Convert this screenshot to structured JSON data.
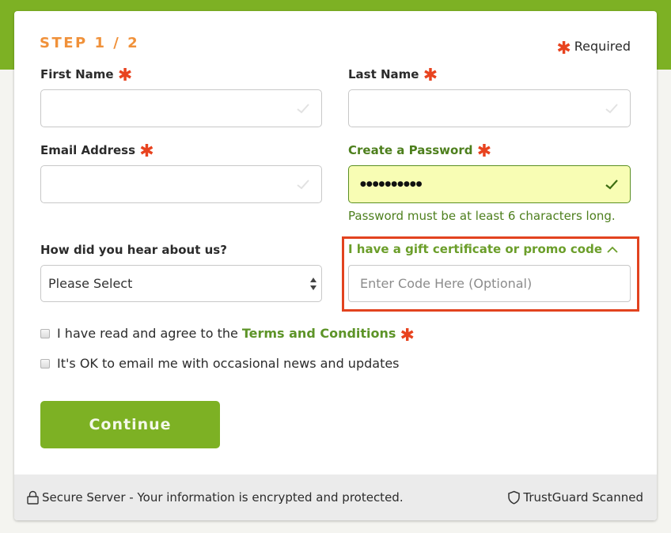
{
  "colors": {
    "brand_green": "#7db124",
    "step_orange": "#f0913a",
    "required_red": "#e8431f",
    "valid_bg": "#f8fdb4",
    "link_green": "#5d9428",
    "highlight_red": "#e2431f"
  },
  "header": {
    "step_label": "STEP 1 / 2",
    "required_asterisk": "✱",
    "required_label": "Required"
  },
  "fields": {
    "first_name": {
      "label": "First Name",
      "asterisk": "✱",
      "value": "",
      "placeholder": "",
      "icon": "check-icon"
    },
    "last_name": {
      "label": "Last Name",
      "asterisk": "✱",
      "value": "",
      "placeholder": "",
      "icon": "check-icon"
    },
    "email": {
      "label": "Email Address",
      "asterisk": "✱",
      "value": "",
      "placeholder": "",
      "icon": "check-icon"
    },
    "password": {
      "label": "Create a Password",
      "asterisk": "✱",
      "value": "●●●●●●●●●●",
      "placeholder": "",
      "icon": "check-icon",
      "hint": "Password must be at least 6 characters long."
    },
    "referral": {
      "label": "How did you hear about us?",
      "selected": "Please Select"
    },
    "promo": {
      "toggle_label": "I have a gift certificate or promo code",
      "toggle_icon": "chevron-up-icon",
      "value": "",
      "placeholder": "Enter Code Here (Optional)"
    }
  },
  "checkboxes": [
    {
      "label": "I have read and agree to the",
      "link": "Terms and Conditions",
      "asterisk": "✱",
      "checked": false
    },
    {
      "label": "It's OK to email me with occasional news and updates",
      "checked": false
    }
  ],
  "actions": {
    "continue_label": "Continue"
  },
  "footer": {
    "secure_icon": "lock-icon",
    "secure_text": "Secure Server - Your information is encrypted and protected.",
    "trust_icon": "shield-icon",
    "trust_text": "TrustGuard Scanned"
  }
}
